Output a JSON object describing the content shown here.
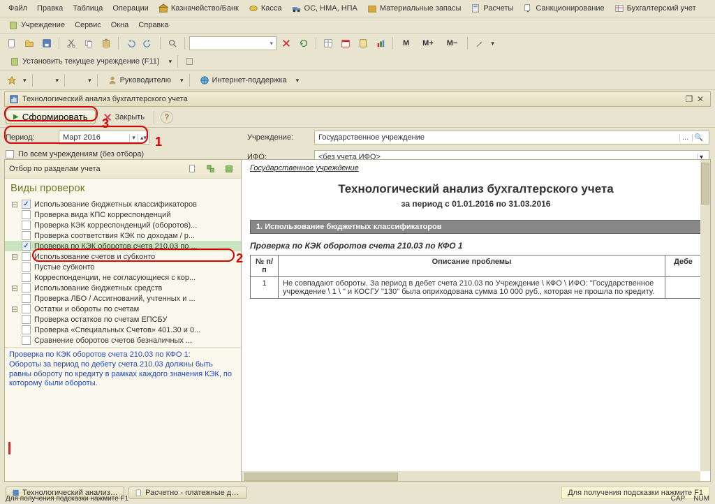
{
  "menu1": {
    "file": "Файл",
    "edit": "Правка",
    "table": "Таблица",
    "ops": "Операции",
    "treasury": "Казначейство/Банк",
    "cash": "Касса",
    "fixed": "ОС, НМА, НПА",
    "materials": "Материальные запасы",
    "calc": "Расчеты",
    "sanction": "Санкционирование",
    "account": "Бухгалтерский учет"
  },
  "menu2": {
    "org": "Учреждение",
    "service": "Сервис",
    "windows": "Окна",
    "help": "Справка"
  },
  "toolbar": {
    "m": "M",
    "mplus": "M+",
    "mminus": "M−"
  },
  "linkbar": {
    "set_current": "Установить текущее учреждение (F11)"
  },
  "linkbar2": {
    "lead": "Руководителю",
    "support": "Интернет-поддержка"
  },
  "window": {
    "title": "Технологический анализ бухгалтерского учета"
  },
  "actions": {
    "generate": "Сформировать",
    "close": "Закрыть"
  },
  "filters": {
    "period_label": "Период:",
    "period_value": "Март 2016",
    "all_orgs": "По всем учреждениям (без отбора)",
    "org_label": "Учреждение:",
    "org_value": "Государственное учреждение",
    "ifo_label": "ИФО:",
    "ifo_value": "<без учета ИФО>"
  },
  "sidebar": {
    "filter_label": "Отбор по разделам учета",
    "title": "Виды проверок",
    "nodes": [
      {
        "l": 0,
        "ex": true,
        "chk": true,
        "t": "Использование бюджетных классификаторов"
      },
      {
        "l": 1,
        "chk": false,
        "t": "Проверка вида КПС корреспонденций"
      },
      {
        "l": 1,
        "chk": false,
        "t": "Проверка КЭК корреспонденций (оборотов)..."
      },
      {
        "l": 1,
        "chk": false,
        "t": "Проверка соответствия КЭК по доходам / р..."
      },
      {
        "l": 1,
        "chk": true,
        "sel": true,
        "t": "Проверка по КЭК оборотов счета 210.03 по ..."
      },
      {
        "l": 0,
        "ex": true,
        "chk": false,
        "t": "Использование счетов и субконто"
      },
      {
        "l": 1,
        "chk": false,
        "t": "Пустые субконто"
      },
      {
        "l": 1,
        "chk": false,
        "t": "Корреспонденции, не согласующиеся с кор..."
      },
      {
        "l": 0,
        "ex": true,
        "chk": false,
        "t": "Использование бюджетных средств"
      },
      {
        "l": 1,
        "chk": false,
        "t": "Проверка ЛБО / Ассигнований, учтенных и ..."
      },
      {
        "l": 0,
        "ex": true,
        "chk": false,
        "t": "Остатки и обороты по счетам"
      },
      {
        "l": 1,
        "chk": false,
        "t": "Проверка остатков по счетам ЕПСБУ"
      },
      {
        "l": 1,
        "chk": false,
        "t": "Проверка «Специальных Счетов» 401.30 и 0..."
      },
      {
        "l": 1,
        "chk": false,
        "t": "Сравнение оборотов счетов безналичных ..."
      }
    ],
    "hint": "Проверка по КЭК оборотов счета 210.03 по КФО 1:\nОбороты за период по дебету счета 210.03 должны быть равны обороту по кредиту в рамках каждого значения КЭК, по которому были обороты."
  },
  "report": {
    "org": "Государственное учреждение",
    "title": "Технологический анализ бухгалтерского учета",
    "period": "за период с   01.01.2016   по   31.03.2016",
    "section1": "1. Использование бюджетных классификаторов",
    "check_title": "Проверка по КЭК оборотов счета 210.03 по КФО 1",
    "th_n": "№ п/п",
    "th_desc": "Описание проблемы",
    "th_deb": "Дебе",
    "rows": [
      {
        "n": "1",
        "desc": "Не совпадают обороты. За период в дебет счета 210.03 по Учреждение \\ КФО \\ ИФО: \"Государственное учреждение \\ 1 \\ \" и КОСГУ \"130\" была оприходована сумма 10 000 руб., которая не прошла по кредиту."
      }
    ]
  },
  "status": {
    "tab1": "Технологический анализ бу...",
    "tab2": "Расчетно - платежные доку...",
    "hint": "Для получения подсказки нажмите F1",
    "bottom_hint": "Для получения подсказки нажмите F1",
    "cap": "CAP",
    "num": "NUM"
  }
}
